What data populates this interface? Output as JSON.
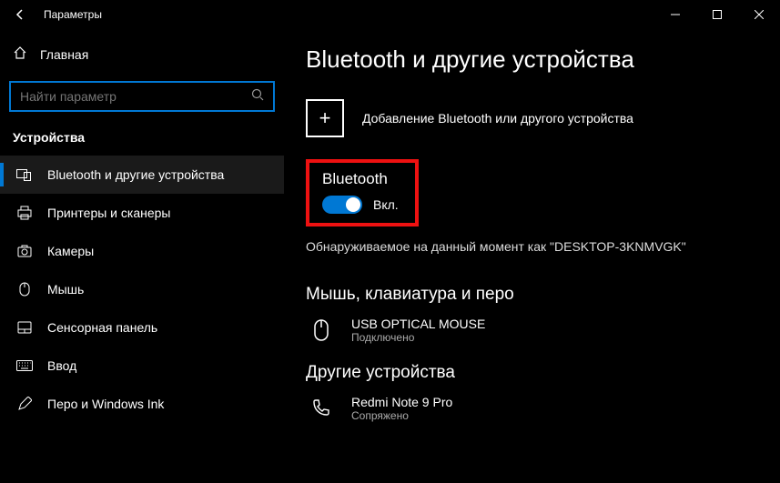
{
  "titlebar": {
    "title": "Параметры"
  },
  "sidebar": {
    "home": "Главная",
    "search_placeholder": "Найти параметр",
    "section": "Устройства",
    "items": [
      {
        "label": "Bluetooth и другие устройства"
      },
      {
        "label": "Принтеры и сканеры"
      },
      {
        "label": "Камеры"
      },
      {
        "label": "Мышь"
      },
      {
        "label": "Сенсорная панель"
      },
      {
        "label": "Ввод"
      },
      {
        "label": "Перо и Windows Ink"
      }
    ]
  },
  "main": {
    "title": "Bluetooth и другие устройства",
    "add_label": "Добавление Bluetooth или другого устройства",
    "bluetooth_label": "Bluetooth",
    "toggle_text": "Вкл.",
    "toggle_on": true,
    "discoverable": "Обнаруживаемое на данный момент как \"DESKTOP-3KNMVGK\"",
    "section1": "Мышь, клавиатура и перо",
    "device1": {
      "name": "USB OPTICAL MOUSE",
      "status": "Подключено"
    },
    "section2": "Другие устройства",
    "device2": {
      "name": "Redmi Note 9 Pro",
      "status": "Сопряжено"
    }
  }
}
